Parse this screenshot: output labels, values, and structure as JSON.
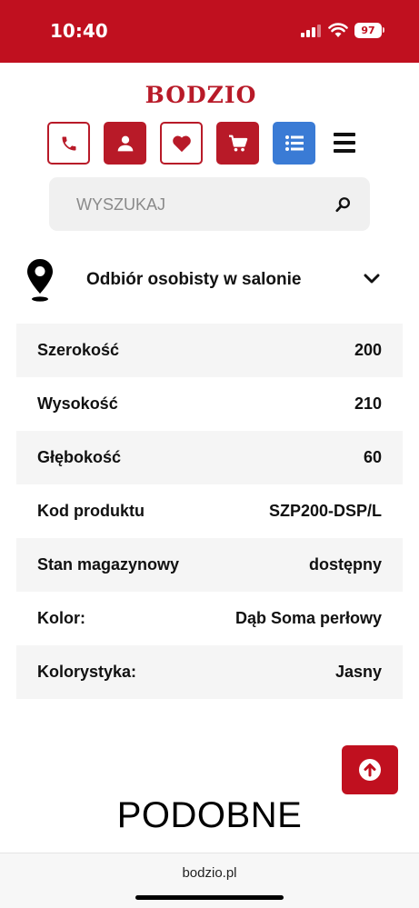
{
  "status_bar": {
    "time": "10:40",
    "battery": "97",
    "background": "#c0101f"
  },
  "brand": {
    "logo_text": "BODZIO",
    "color": "#b81a28"
  },
  "toolbar": {
    "buttons": [
      {
        "name": "phone-icon",
        "style": "outline"
      },
      {
        "name": "user-icon",
        "style": "filled"
      },
      {
        "name": "heart-icon",
        "style": "outline"
      },
      {
        "name": "cart-icon",
        "style": "filled"
      },
      {
        "name": "list-icon",
        "style": "blue"
      },
      {
        "name": "hamburger-menu-icon",
        "style": "plain"
      }
    ],
    "accent_blue": "#3a7bd5"
  },
  "search": {
    "placeholder": "WYSZUKAJ"
  },
  "delivery": {
    "label": "Odbiór osobisty w salonie"
  },
  "specs": [
    {
      "label": "Szerokość",
      "value": "200"
    },
    {
      "label": "Wysokość",
      "value": "210"
    },
    {
      "label": "Głębokość",
      "value": "60"
    },
    {
      "label": "Kod produktu",
      "value": "SZP200-DSP/L"
    },
    {
      "label": "Stan magazynowy",
      "value": "dostępny"
    },
    {
      "label": "Kolor:",
      "value": "Dąb Soma perłowy"
    },
    {
      "label": "Kolorystyka:",
      "value": "Jasny"
    }
  ],
  "similar": {
    "title": "PODOBNE"
  },
  "browser": {
    "url": "bodzio.pl"
  }
}
